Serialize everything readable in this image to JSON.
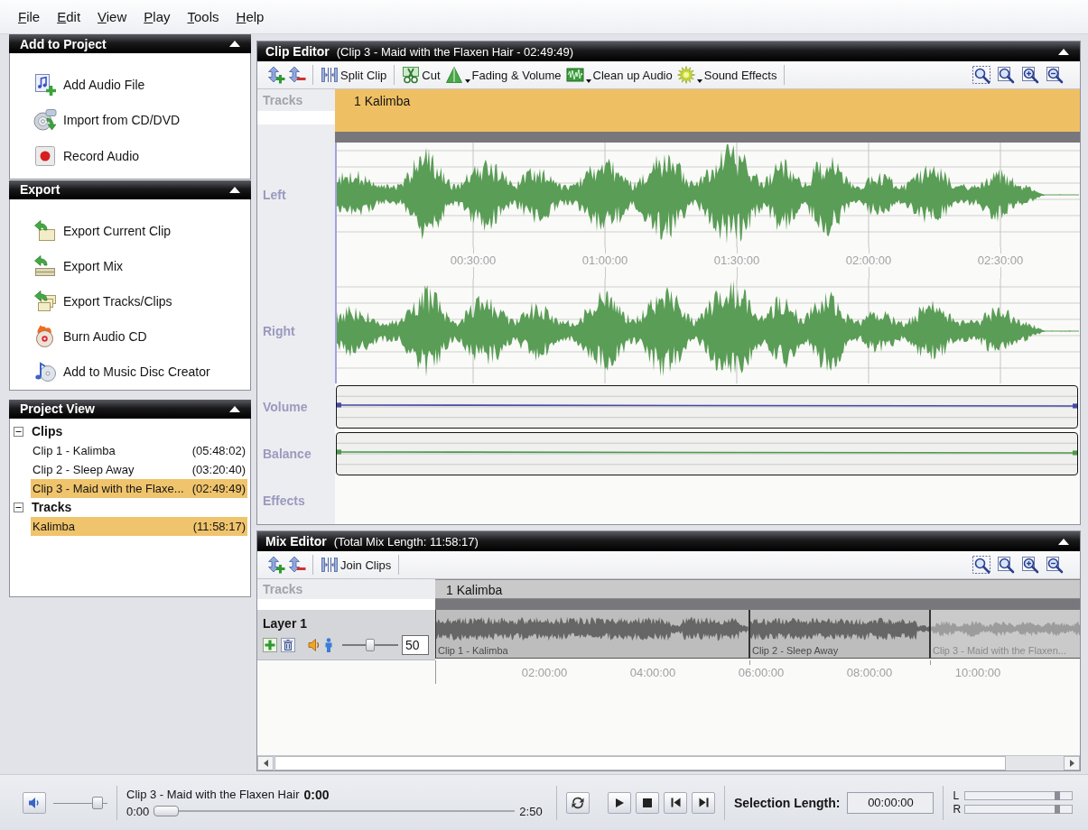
{
  "menu": [
    "File",
    "Edit",
    "View",
    "Play",
    "Tools",
    "Help"
  ],
  "sidebar": [
    {
      "title": "Add to Project",
      "expanded": true,
      "items": [
        "Add Audio File",
        "Import from CD/DVD",
        "Record Audio"
      ]
    },
    {
      "title": "Export",
      "expanded": true,
      "items": [
        "Export Current Clip",
        "Export Mix",
        "Export Tracks/Clips",
        "Burn Audio CD",
        "Add to Music Disc Creator"
      ]
    }
  ],
  "project_view": {
    "title": "Project View",
    "expanded": true,
    "tree": [
      {
        "label": "Clips",
        "expanded": true,
        "children": [
          {
            "label": "Clip 1 - Kalimba",
            "duration": "(05:48:02)",
            "selected": false
          },
          {
            "label": "Clip 2 - Sleep Away",
            "duration": "(03:20:40)",
            "selected": false
          },
          {
            "label": "Clip 3 - Maid with the Flaxe...",
            "duration": "(02:49:49)",
            "selected": true
          }
        ]
      },
      {
        "label": "Tracks",
        "expanded": true,
        "children": [
          {
            "label": "Kalimba",
            "duration": "(11:58:17)",
            "selected": true
          }
        ]
      }
    ]
  },
  "clip_editor": {
    "title": "Clip Editor",
    "subtitle": "(Clip 3 - Maid with the Flaxen Hair - 02:49:49)",
    "expanded": true,
    "toolbar": [
      {
        "label": "Split Clip",
        "dropdown": false
      },
      {
        "label": "Cut",
        "dropdown": false
      },
      {
        "label": "Fading & Volume",
        "dropdown": true
      },
      {
        "label": "Clean up Audio",
        "dropdown": true
      },
      {
        "label": "Sound Effects",
        "dropdown": true
      }
    ],
    "tracks_label": "Tracks",
    "track": "1 Kalimba",
    "lanes": [
      {
        "label": "Left",
        "kind": "wave"
      },
      {
        "label": "Right",
        "kind": "wave"
      },
      {
        "label": "Volume",
        "kind": "envelope",
        "color": "#4848a8"
      },
      {
        "label": "Balance",
        "kind": "envelope",
        "color": "#4c9a4c"
      },
      {
        "label": "Effects",
        "kind": "empty"
      }
    ],
    "time_ticks": [
      "00:30:00",
      "01:00:00",
      "01:30:00",
      "02:00:00",
      "02:30:00"
    ]
  },
  "mix_editor": {
    "title": "Mix Editor",
    "subtitle": "(Total Mix Length: 11:58:17)",
    "expanded": true,
    "toolbar": [
      {
        "label": "Join Clips",
        "dropdown": false
      }
    ],
    "tracks_label": "Tracks",
    "track": "1 Kalimba",
    "layer": {
      "name": "Layer 1",
      "level": 0.5,
      "value": "50"
    },
    "clips": [
      {
        "label": "Clip 1 - Kalimba",
        "selected": false
      },
      {
        "label": "Clip 2 - Sleep Away",
        "selected": false
      },
      {
        "label": "Clip 3 - Maid with the Flaxen...",
        "selected": true
      }
    ],
    "time_ticks": [
      "02:00:00",
      "04:00:00",
      "06:00:00",
      "08:00:00",
      "10:00:00"
    ]
  },
  "player": {
    "title": "Clip 3 - Maid with the Flaxen Hair",
    "position": "0:00",
    "start": "0:00",
    "end": "2:50",
    "volume": {
      "level": 0.9
    },
    "seek": {
      "level": 0
    },
    "selection_label": "Selection Length:",
    "selection_value": "00:00:00",
    "meters": [
      {
        "label": "L",
        "level": 0.88
      },
      {
        "label": "R",
        "level": 0.88
      }
    ]
  }
}
